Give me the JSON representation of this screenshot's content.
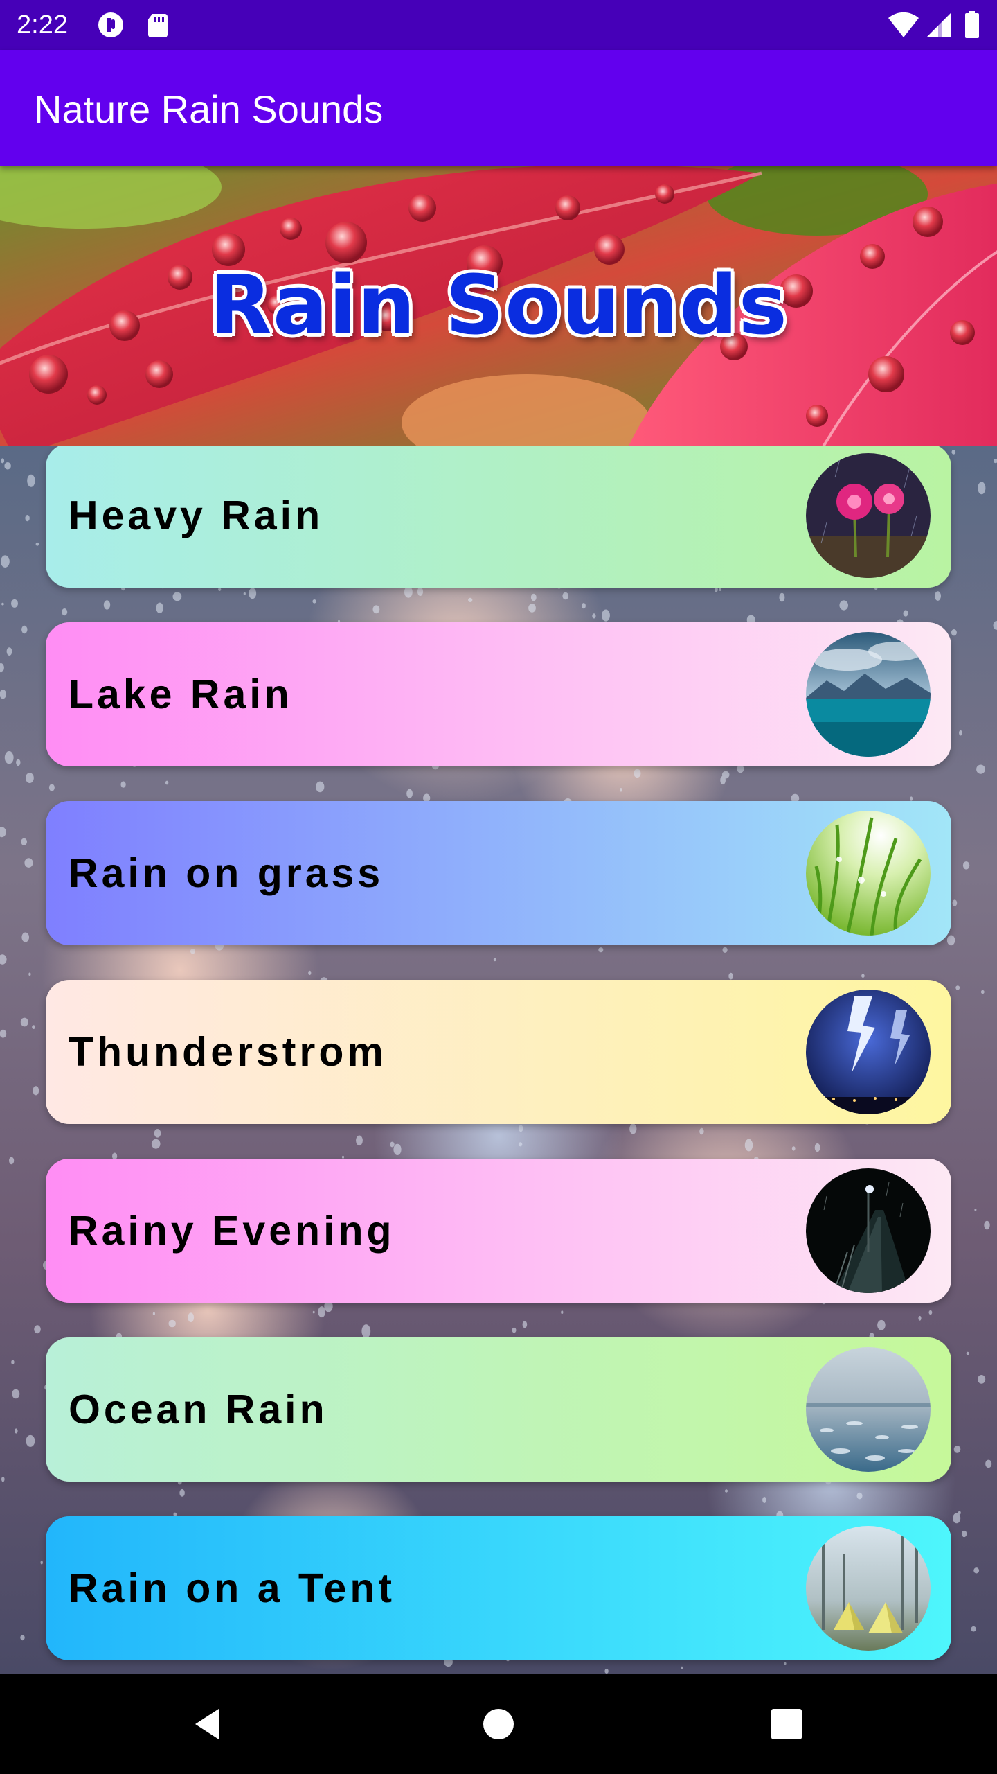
{
  "status_bar": {
    "time": "2:22",
    "icons": [
      "notification-icon",
      "sd-card-icon",
      "wifi-icon",
      "signal-icon",
      "battery-icon"
    ]
  },
  "app_bar": {
    "title": "Nature Rain Sounds",
    "color": "#6200ee"
  },
  "banner": {
    "title": "Rain Sounds"
  },
  "sounds": [
    {
      "label": "Heavy Rain",
      "gradient": [
        "#a8edea",
        "#b9f3a2"
      ],
      "image": "pink-flowers-rain"
    },
    {
      "label": "Lake Rain",
      "gradient": [
        "#ff8df4",
        "#fde9f4"
      ],
      "image": "mountain-lake"
    },
    {
      "label": "Rain on grass",
      "gradient": [
        "#7f7fff",
        "#a2e6f8"
      ],
      "image": "grass-dew"
    },
    {
      "label": "Thunderstrom",
      "gradient": [
        "#ffe8e4",
        "#fef6a0"
      ],
      "image": "lightning-storm"
    },
    {
      "label": "Rainy Evening",
      "gradient": [
        "#ff8df4",
        "#fde9f4"
      ],
      "image": "night-street"
    },
    {
      "label": "Ocean Rain",
      "gradient": [
        "#b8f0d8",
        "#c6f89a"
      ],
      "image": "rain-on-water"
    },
    {
      "label": "Rain on a Tent",
      "gradient": [
        "#22b6fb",
        "#4ef6fc"
      ],
      "image": "tents-in-forest"
    }
  ],
  "nav_bar": {
    "buttons": [
      "back-icon",
      "home-icon",
      "recents-icon"
    ]
  }
}
